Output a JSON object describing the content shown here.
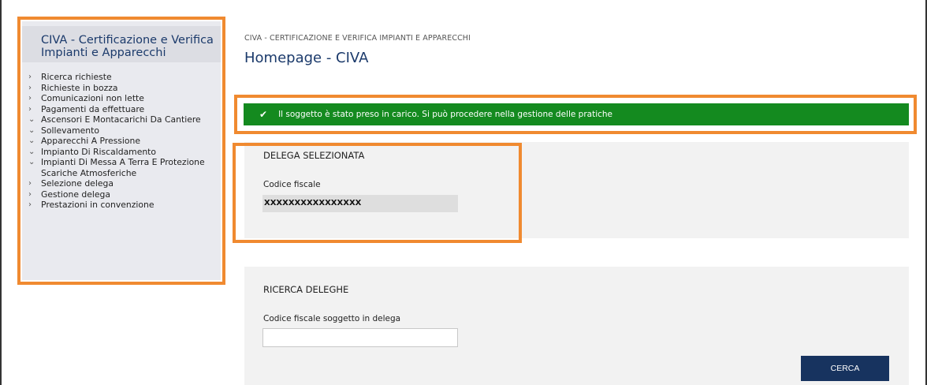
{
  "sidebar": {
    "title": "CIVA - Certificazione e Verifica Impianti e Apparecchi",
    "items": [
      {
        "label": "Ricerca richieste",
        "chevron": "›"
      },
      {
        "label": "Richieste in bozza",
        "chevron": "›"
      },
      {
        "label": "Comunicazioni non lette",
        "chevron": "›"
      },
      {
        "label": "Pagamenti da effettuare",
        "chevron": "›"
      },
      {
        "label": "Ascensori E Montacarichi Da Cantiere",
        "chevron": "⌄"
      },
      {
        "label": "Sollevamento",
        "chevron": "⌄"
      },
      {
        "label": "Apparecchi A Pressione",
        "chevron": "⌄"
      },
      {
        "label": "Impianto Di Riscaldamento",
        "chevron": "⌄"
      },
      {
        "label": "Impianti Di Messa A Terra E Protezione Scariche Atmosferiche",
        "chevron": "⌄"
      },
      {
        "label": "Selezione delega",
        "chevron": "›"
      },
      {
        "label": "Gestione delega",
        "chevron": "›"
      },
      {
        "label": "Prestazioni in convenzione",
        "chevron": "›"
      }
    ]
  },
  "header": {
    "breadcrumb": "CIVA - CERTIFICAZIONE E VERIFICA IMPIANTI E APPARECCHI",
    "title": "Homepage - CIVA"
  },
  "alert": {
    "icon": "check-icon",
    "message": "Il soggetto è stato preso in carico. Si può procedere nella gestione delle pratiche",
    "color": "#148a1f"
  },
  "delega": {
    "title": "DELEGA SELEZIONATA",
    "field_label": "Codice fiscale",
    "field_value": "XXXXXXXXXXXXXXXX"
  },
  "ricerca": {
    "title": "RICERCA DELEGHE",
    "field_label": "Codice fiscale soggetto in delega",
    "field_value": "",
    "button_label": "CERCA"
  },
  "colors": {
    "highlight": "#f08a30",
    "primary": "#17335f",
    "title": "#1b3a6b"
  }
}
